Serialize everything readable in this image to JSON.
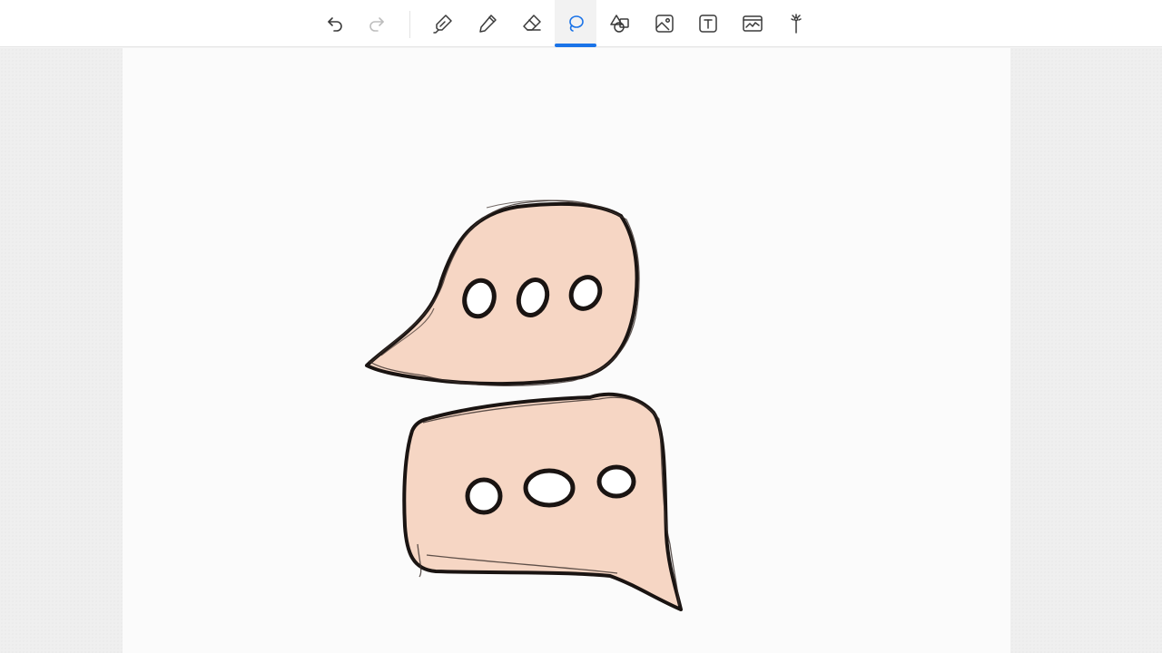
{
  "toolbar": {
    "active_tool": "lasso",
    "accent_color": "#1a73e8",
    "tools": [
      {
        "id": "undo",
        "icon": "undo-icon"
      },
      {
        "id": "redo",
        "icon": "redo-icon"
      },
      {
        "id": "highlighter",
        "icon": "highlighter-icon"
      },
      {
        "id": "pen",
        "icon": "pen-icon"
      },
      {
        "id": "eraser",
        "icon": "eraser-icon"
      },
      {
        "id": "lasso",
        "icon": "lasso-icon"
      },
      {
        "id": "shapes",
        "icon": "shapes-icon"
      },
      {
        "id": "image",
        "icon": "image-icon"
      },
      {
        "id": "text",
        "icon": "text-box-icon"
      },
      {
        "id": "chart",
        "icon": "chart-icon"
      },
      {
        "id": "magic",
        "icon": "magic-wand-icon"
      }
    ]
  },
  "canvas": {
    "bubble_fill": "#f6d6c4",
    "stroke_color": "#1a1412"
  }
}
